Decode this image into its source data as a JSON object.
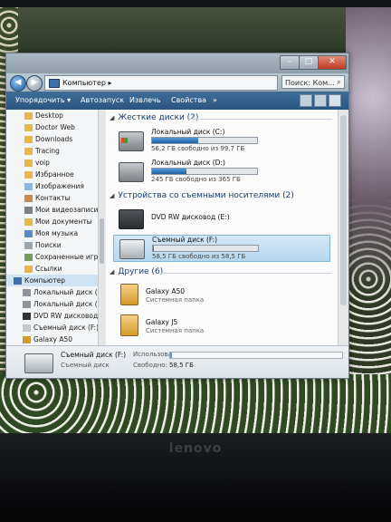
{
  "window": {
    "address": "Компьютер",
    "search_placeholder": "Поиск: Ком..."
  },
  "toolbar": {
    "organize": "Упорядочить ▾",
    "autoplay": "Автозапуск",
    "eject": "Извлечь",
    "properties": "Свойства",
    "more": "»"
  },
  "navpane": {
    "items": [
      {
        "label": "Desktop"
      },
      {
        "label": "Doctor Web"
      },
      {
        "label": "Downloads"
      },
      {
        "label": "Tracing"
      },
      {
        "label": "voip"
      },
      {
        "label": "Избранное"
      },
      {
        "label": "Изображения"
      },
      {
        "label": "Контакты"
      },
      {
        "label": "Мои видеозаписи"
      },
      {
        "label": "Мои документы"
      },
      {
        "label": "Моя музыка"
      },
      {
        "label": "Поиски"
      },
      {
        "label": "Сохраненные игры"
      },
      {
        "label": "Ссылки"
      },
      {
        "label": "Компьютер"
      },
      {
        "label": "Локальный диск (C:"
      },
      {
        "label": "Локальный диск (D:"
      },
      {
        "label": "DVD RW дисковод ("
      },
      {
        "label": "Съемный диск (F:)"
      },
      {
        "label": "Galaxy A50"
      }
    ]
  },
  "groups": {
    "hard": "Жесткие диски (2)",
    "removable": "Устройства со съемными носителями (2)",
    "other": "Другие (6)"
  },
  "drives": {
    "c": {
      "name": "Локальный диск (C:)",
      "free": "56,2 ГБ свободно из 99,7 ГБ",
      "used_fraction": 0.44
    },
    "d": {
      "name": "Локальный диск (D:)",
      "free": "245 ГБ свободно из 365 ГБ",
      "used_fraction": 0.33
    },
    "e": {
      "name": "DVD RW дисковод (E:)"
    },
    "f": {
      "name": "Съемный диск (F:)",
      "free": "58,5 ГБ свободно из 58,5 ГБ",
      "used_fraction": 0.0
    }
  },
  "others": [
    {
      "name": "Galaxy A50",
      "type": "Системная папка"
    },
    {
      "name": "Galaxy J5",
      "type": "Системная папка"
    }
  ],
  "details": {
    "name": "Съемный диск (F:)",
    "type": "Съемный диск",
    "used_label": "Использовано:",
    "free_label": "Свободно:",
    "free_value": "58,5 ГБ"
  },
  "brand": "lenovo"
}
